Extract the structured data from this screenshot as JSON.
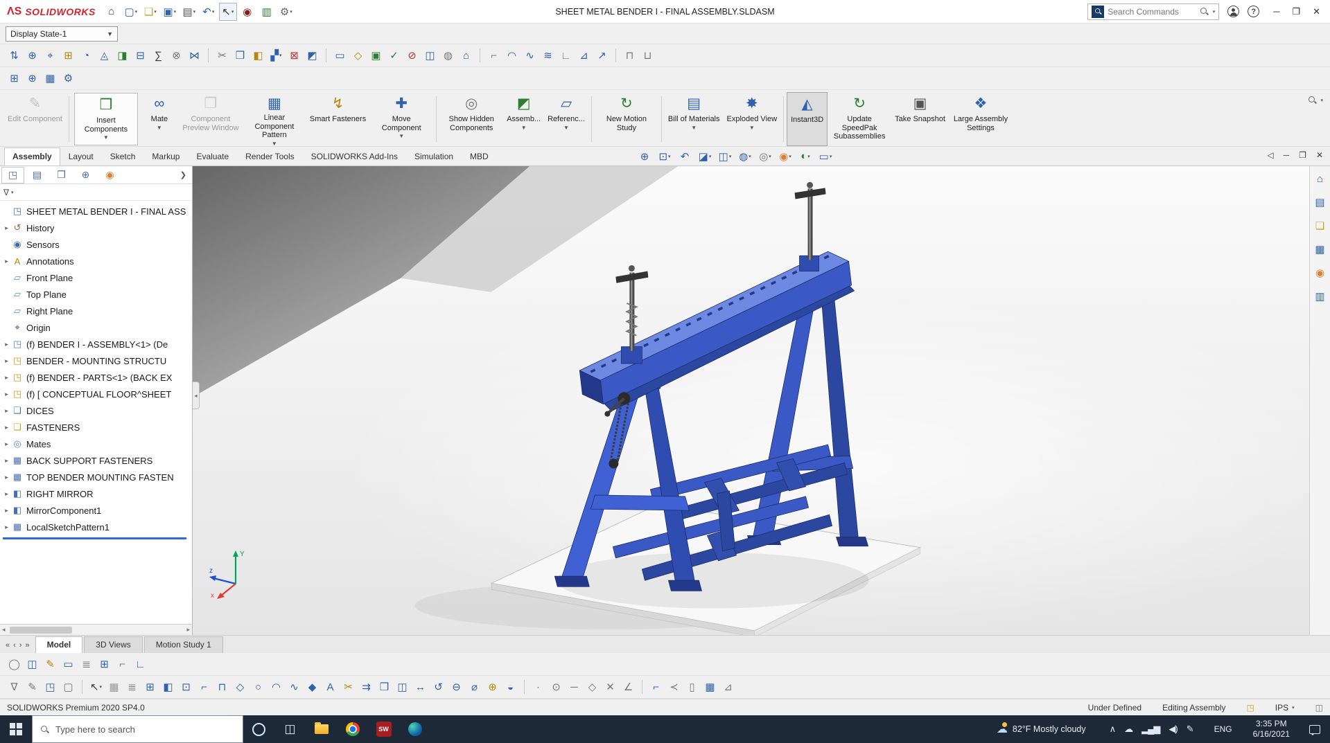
{
  "colors": {
    "accent_blue": "#2f62ad",
    "machine_blue": "#3a59c4",
    "logo_red": "#d1242f",
    "taskbar_bg": "#1d2936",
    "selection_blue": "#2b6cd4"
  },
  "titlebar": {
    "logo_mark": "ΛS",
    "logo_text": "SOLIDWORKS",
    "title": "SHEET METAL BENDER I - FINAL ASSEMBLY.SLDASM",
    "search_placeholder": "Search Commands",
    "quick_access": [
      {
        "n": "home-icon",
        "g": "⌂",
        "c": "#444"
      },
      {
        "n": "new-document-icon",
        "g": "▢",
        "c": "#2f62ad",
        "dd": true
      },
      {
        "n": "open-icon",
        "g": "❏",
        "c": "#c9a227",
        "dd": true
      },
      {
        "n": "save-icon",
        "g": "▣",
        "c": "#2f62ad",
        "dd": true
      },
      {
        "n": "print-icon",
        "g": "▤",
        "c": "#555",
        "dd": true
      },
      {
        "n": "undo-icon",
        "g": "↶",
        "c": "#2f62ad",
        "dd": true
      },
      {
        "n": "select-arrow-icon",
        "g": "↖",
        "c": "#333",
        "dd": true,
        "boxed": true
      },
      {
        "n": "play-record-icon",
        "g": "◉",
        "c": "#8b1a1a"
      },
      {
        "n": "report-icon",
        "g": "▥",
        "c": "#2e7d32"
      },
      {
        "n": "options-gear-icon",
        "g": "⚙",
        "c": "#666",
        "dd": true
      }
    ]
  },
  "menurow": {
    "display_state": "Display State-1"
  },
  "toolbars": {
    "row1": [
      [
        {
          "g": "⇅",
          "c": "#2f62ad"
        },
        {
          "g": "⊕",
          "c": "#2f62ad"
        },
        {
          "g": "⌖",
          "c": "#2f62ad"
        },
        {
          "g": "⊞",
          "c": "#b8860b"
        },
        {
          "g": "◔",
          "c": "#2f62ad"
        },
        {
          "g": "◬",
          "c": "#2f62ad"
        },
        {
          "g": "◨",
          "c": "#2e7d32"
        },
        {
          "g": "⊟",
          "c": "#2f62ad"
        },
        {
          "g": "∑",
          "c": "#333"
        },
        {
          "g": "⊗",
          "c": "#777"
        },
        {
          "g": "⋈",
          "c": "#2f62ad"
        }
      ],
      [
        {
          "g": "✂",
          "c": "#777"
        },
        {
          "g": "❒",
          "c": "#2f62ad"
        },
        {
          "g": "◧",
          "c": "#b8860b"
        },
        {
          "g": "▞",
          "c": "#2f62ad",
          "dd": true
        },
        {
          "g": "⊠",
          "c": "#c03030"
        },
        {
          "g": "◩",
          "c": "#2f62ad"
        }
      ],
      [
        {
          "g": "▭",
          "c": "#2f62ad"
        },
        {
          "g": "◇",
          "c": "#b8860b"
        },
        {
          "g": "▣",
          "c": "#2e7d32"
        },
        {
          "g": "✓",
          "c": "#2e7d32"
        },
        {
          "g": "⊘",
          "c": "#c03030"
        },
        {
          "g": "◫",
          "c": "#2f62ad"
        },
        {
          "g": "◍",
          "c": "#777"
        },
        {
          "g": "⌂",
          "c": "#2f62ad"
        }
      ],
      [
        {
          "g": "⌐",
          "c": "#777"
        },
        {
          "g": "◠",
          "c": "#2f62ad"
        },
        {
          "g": "∿",
          "c": "#2f62ad"
        },
        {
          "g": "≋",
          "c": "#2f62ad"
        },
        {
          "g": "∟",
          "c": "#777"
        },
        {
          "g": "⊿",
          "c": "#2f62ad"
        },
        {
          "g": "↗",
          "c": "#2f62ad"
        }
      ],
      [
        {
          "g": "⊓",
          "c": "#777"
        },
        {
          "g": "⊔",
          "c": "#777"
        }
      ]
    ],
    "row2": [
      [
        {
          "g": "⊞",
          "c": "#2f62ad"
        },
        {
          "g": "⊕",
          "c": "#2f62ad"
        },
        {
          "g": "▦",
          "c": "#2f62ad"
        },
        {
          "g": "⚙",
          "c": "#2f62ad"
        }
      ]
    ],
    "bottom1": [
      [
        {
          "g": "◯",
          "c": "#777"
        },
        {
          "g": "◫",
          "c": "#2f62ad"
        },
        {
          "g": "✎",
          "c": "#b8860b"
        },
        {
          "g": "▭",
          "c": "#2f62ad"
        },
        {
          "g": "≣",
          "c": "#777"
        },
        {
          "g": "⊞",
          "c": "#2f62ad"
        },
        {
          "g": "⌐",
          "c": "#777"
        },
        {
          "g": "∟",
          "c": "#2f62ad"
        }
      ]
    ],
    "bottom2": [
      [
        {
          "g": "∇",
          "c": "#777"
        },
        {
          "g": "✎",
          "c": "#777"
        },
        {
          "g": "◳",
          "c": "#2f62ad"
        },
        {
          "g": "▢",
          "c": "#777"
        }
      ],
      [
        {
          "g": "↖",
          "c": "#333",
          "dd": true
        },
        {
          "g": "▦",
          "c": "#999"
        },
        {
          "g": "≣",
          "c": "#777"
        },
        {
          "g": "⊞",
          "c": "#2f62ad"
        },
        {
          "g": "◧",
          "c": "#2f62ad"
        },
        {
          "g": "⊡",
          "c": "#2f62ad"
        },
        {
          "g": "⌐",
          "c": "#2f62ad"
        },
        {
          "g": "⊓",
          "c": "#2f62ad"
        },
        {
          "g": "◇",
          "c": "#2f62ad"
        },
        {
          "g": "○",
          "c": "#2f62ad"
        },
        {
          "g": "◠",
          "c": "#2f62ad"
        },
        {
          "g": "∿",
          "c": "#2f62ad"
        },
        {
          "g": "◆",
          "c": "#2f62ad"
        },
        {
          "g": "A",
          "c": "#2f62ad"
        },
        {
          "g": "✂",
          "c": "#b8860b"
        },
        {
          "g": "⇉",
          "c": "#2f62ad"
        },
        {
          "g": "❒",
          "c": "#2f62ad"
        },
        {
          "g": "◫",
          "c": "#2f62ad"
        },
        {
          "g": "↔",
          "c": "#2f62ad"
        },
        {
          "g": "↺",
          "c": "#2f62ad"
        },
        {
          "g": "⊖",
          "c": "#2f62ad"
        },
        {
          "g": "⌀",
          "c": "#2f62ad"
        },
        {
          "g": "⊕",
          "c": "#b8860b"
        },
        {
          "g": "◒",
          "c": "#2f62ad"
        }
      ],
      [
        {
          "g": "∙",
          "c": "#777"
        },
        {
          "g": "⊙",
          "c": "#777"
        },
        {
          "g": "─",
          "c": "#777"
        },
        {
          "g": "◇",
          "c": "#777"
        },
        {
          "g": "✕",
          "c": "#777"
        },
        {
          "g": "∠",
          "c": "#777"
        }
      ],
      [
        {
          "g": "⌐",
          "c": "#2f62ad"
        },
        {
          "g": "≺",
          "c": "#777"
        },
        {
          "g": "▯",
          "c": "#777"
        },
        {
          "g": "▦",
          "c": "#2f62ad"
        },
        {
          "g": "⊿",
          "c": "#777"
        }
      ]
    ]
  },
  "ribbon": {
    "tabs": [
      "Assembly",
      "Layout",
      "Sketch",
      "Markup",
      "Evaluate",
      "Render Tools",
      "SOLIDWORKS Add-Ins",
      "Simulation",
      "MBD"
    ],
    "active_tab": "Assembly",
    "buttons": [
      {
        "label": "Edit Component",
        "g": "✎",
        "c": "#8a8a8a",
        "disabled": true
      },
      {
        "sep": true
      },
      {
        "label": "Insert Components",
        "g": "❒",
        "c": "#2e7d32",
        "dd": true,
        "boxed": true
      },
      {
        "label": "Mate",
        "g": "∞",
        "c": "#2f62ad",
        "dd": true
      },
      {
        "label": "Component Preview Window",
        "g": "❐",
        "c": "#9a9a9a",
        "disabled": true
      },
      {
        "label": "Linear Component Pattern",
        "g": "▦",
        "c": "#2f62ad",
        "dd": true
      },
      {
        "label": "Smart Fasteners",
        "g": "↯",
        "c": "#b8860b"
      },
      {
        "label": "Move Component",
        "g": "✚",
        "c": "#2f62ad",
        "dd": true
      },
      {
        "sep": true
      },
      {
        "label": "Show Hidden Components",
        "g": "◎",
        "c": "#777"
      },
      {
        "label": "Assemb...",
        "g": "◩",
        "c": "#2e7d32",
        "dd": true
      },
      {
        "label": "Referenc...",
        "g": "▱",
        "c": "#2f62ad",
        "dd": true
      },
      {
        "sep": true
      },
      {
        "label": "New Motion Study",
        "g": "↻",
        "c": "#2e7d32"
      },
      {
        "sep": true
      },
      {
        "label": "Bill of Materials",
        "g": "▤",
        "c": "#2f62ad",
        "dd": true
      },
      {
        "label": "Exploded View",
        "g": "✸",
        "c": "#2f62ad",
        "dd": true
      },
      {
        "sep": true
      },
      {
        "label": "Instant3D",
        "g": "◭",
        "c": "#2f62ad",
        "active": true
      },
      {
        "label": "Update SpeedPak Subassemblies",
        "g": "↻",
        "c": "#2e7d32"
      },
      {
        "label": "Take Snapshot",
        "g": "▣",
        "c": "#555"
      },
      {
        "label": "Large Assembly Settings",
        "g": "❖",
        "c": "#2f62ad"
      }
    ]
  },
  "headsup": [
    {
      "n": "zoom-fit-icon",
      "g": "⊕",
      "c": "#2f62ad"
    },
    {
      "n": "zoom-area-icon",
      "g": "⊡",
      "c": "#2f62ad",
      "dd": true
    },
    {
      "n": "previous-view-icon",
      "g": "↶",
      "c": "#2f62ad"
    },
    {
      "n": "section-view-icon",
      "g": "◪",
      "c": "#2f62ad",
      "dd": true
    },
    {
      "n": "view-orientation-icon",
      "g": "◫",
      "c": "#2f62ad",
      "dd": true
    },
    {
      "n": "display-style-icon",
      "g": "◍",
      "c": "#2f62ad",
      "dd": true
    },
    {
      "n": "hide-show-items-icon",
      "g": "◎",
      "c": "#777",
      "dd": true
    },
    {
      "n": "edit-appearance-icon",
      "g": "◉",
      "c": "#e07b2a",
      "dd": true
    },
    {
      "n": "apply-scene-icon",
      "g": "◐",
      "c": "#2e7d32",
      "dd": true
    },
    {
      "n": "view-settings-icon",
      "g": "▭",
      "c": "#2f62ad",
      "dd": true
    }
  ],
  "doc_controls": [
    {
      "n": "previous-document-icon",
      "g": "◁"
    },
    {
      "n": "minimize-document-icon",
      "g": "─"
    },
    {
      "n": "restore-document-icon",
      "g": "❐"
    },
    {
      "n": "close-document-icon",
      "g": "✕"
    }
  ],
  "panel": {
    "tabs": [
      {
        "n": "featuremanager-tab",
        "g": "◳",
        "c": "#4a6fb0",
        "active": true
      },
      {
        "n": "propertymanager-tab",
        "g": "▤",
        "c": "#4a6fb0"
      },
      {
        "n": "configurationmanager-tab",
        "g": "❒",
        "c": "#4a6fb0"
      },
      {
        "n": "dimxpertmanager-tab",
        "g": "⊕",
        "c": "#4a6fb0"
      },
      {
        "n": "appearances-tab",
        "g": "◉",
        "c": "#e07b2a"
      }
    ],
    "chevron": "❯",
    "filter_glyph": "∇"
  },
  "tree": {
    "root": {
      "label": "SHEET METAL BENDER I - FINAL ASS",
      "g": "◳",
      "c": "#4a6fb0"
    },
    "items": [
      {
        "label": "History",
        "icon": "history-icon",
        "g": "↺",
        "c": "#8a6d3b",
        "exp": true
      },
      {
        "label": "Sensors",
        "icon": "sensors-icon",
        "g": "◉",
        "c": "#3a6ea8",
        "exp": false
      },
      {
        "label": "Annotations",
        "icon": "annotations-icon",
        "g": "A",
        "c": "#b8860b",
        "exp": true
      },
      {
        "label": "Front Plane",
        "icon": "plane-icon",
        "g": "▱",
        "c": "#4a90d9",
        "exp": false
      },
      {
        "label": "Top Plane",
        "icon": "plane-icon",
        "g": "▱",
        "c": "#4a90d9",
        "exp": false
      },
      {
        "label": "Right Plane",
        "icon": "plane-icon",
        "g": "▱",
        "c": "#4a90d9",
        "exp": false
      },
      {
        "label": "Origin",
        "icon": "origin-icon",
        "g": "⌖",
        "c": "#444",
        "exp": false
      },
      {
        "label": "(f) BENDER I - ASSEMBLY<1> (De",
        "icon": "component-icon",
        "g": "◳",
        "c": "#5b84c4",
        "exp": true
      },
      {
        "label": "BENDER -  MOUNTING STRUCTU",
        "icon": "component-icon",
        "g": "◳",
        "c": "#c9a227",
        "exp": true
      },
      {
        "label": "(f) BENDER - PARTS<1> (BACK EX",
        "icon": "component-icon",
        "g": "◳",
        "c": "#c9a227",
        "exp": true
      },
      {
        "label": "(f) [ CONCEPTUAL FLOOR^SHEET",
        "icon": "component-icon",
        "g": "◳",
        "c": "#c9a227",
        "exp": true
      },
      {
        "label": "DICES",
        "icon": "folder-icon",
        "g": "❏",
        "c": "#3a6ea8",
        "exp": true
      },
      {
        "label": "FASTENERS",
        "icon": "folder-icon",
        "g": "❏",
        "c": "#c9a227",
        "exp": true
      },
      {
        "label": "Mates",
        "icon": "mates-icon",
        "g": "◎",
        "c": "#5b84c4",
        "exp": true
      },
      {
        "label": "BACK SUPPORT FASTENERS",
        "icon": "pattern-icon",
        "g": "▦",
        "c": "#4a6fb0",
        "exp": true
      },
      {
        "label": "TOP BENDER MOUNTING FASTEN",
        "icon": "pattern-icon",
        "g": "▦",
        "c": "#4a6fb0",
        "exp": true
      },
      {
        "label": "RIGHT MIRROR",
        "icon": "mirror-icon",
        "g": "◧",
        "c": "#4a6fb0",
        "exp": true
      },
      {
        "label": "MirrorComponent1",
        "icon": "mirror-icon",
        "g": "◧",
        "c": "#4a6fb0",
        "exp": true
      },
      {
        "label": "LocalSketchPattern1",
        "icon": "sketch-pattern-icon",
        "g": "▦",
        "c": "#4a6fb0",
        "exp": true,
        "selected": true
      }
    ]
  },
  "rpane": [
    {
      "n": "task-pane-home-icon",
      "g": "⌂",
      "c": "#2f62ad"
    },
    {
      "n": "design-library-icon",
      "g": "▤",
      "c": "#2f62ad"
    },
    {
      "n": "file-explorer-pane-icon",
      "g": "❏",
      "c": "#c9a227"
    },
    {
      "n": "view-palette-icon",
      "g": "▦",
      "c": "#2f62ad"
    },
    {
      "n": "appearances-pane-icon",
      "g": "◉",
      "c": "#e07b2a"
    },
    {
      "n": "custom-properties-icon",
      "g": "▥",
      "c": "#2f62ad"
    }
  ],
  "model_tabs": {
    "nav": [
      "«",
      "‹",
      "›",
      "»"
    ],
    "tabs": [
      "Model",
      "3D Views",
      "Motion Study 1"
    ],
    "active": "Model"
  },
  "statusbar": {
    "left": "SOLIDWORKS Premium 2020 SP4.0",
    "status1": "Under Defined",
    "status2": "Editing Assembly",
    "units": "IPS",
    "units_caret": "▾"
  },
  "taskbar": {
    "search_placeholder": "Type here to search",
    "apps": [
      {
        "n": "cortana-icon",
        "type": "cortana"
      },
      {
        "n": "task-view-icon",
        "type": "glyph",
        "g": "◫",
        "c": "#dfe7ef"
      },
      {
        "n": "file-explorer-icon",
        "type": "folder"
      },
      {
        "n": "chrome-icon",
        "type": "chrome"
      },
      {
        "n": "solidworks-icon",
        "type": "sw",
        "label": "SW"
      },
      {
        "n": "edge-icon",
        "type": "edge"
      }
    ],
    "weather": "82°F Mostly cloudy",
    "tray": [
      {
        "n": "hidden-icons-chevron",
        "g": "∧"
      },
      {
        "n": "onedrive-icon",
        "g": "☁"
      },
      {
        "n": "network-icon",
        "g": "▂▄▆"
      },
      {
        "n": "volume-icon",
        "g": "◀)"
      },
      {
        "n": "pen-icon",
        "g": "✎"
      }
    ],
    "language": "ENG",
    "time": "3:35 PM",
    "date": "6/16/2021"
  }
}
